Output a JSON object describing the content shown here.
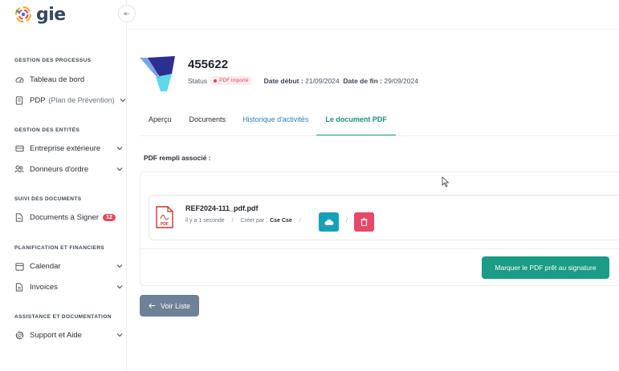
{
  "app": {
    "logo_text": "gie"
  },
  "sidebar": {
    "sections": [
      {
        "title": "GESTION DES PROCESSUS"
      },
      {
        "title": "GESTION DES ENTITÉS"
      },
      {
        "title": "SUIVI DES DOCUMENTS"
      },
      {
        "title": "PLANIFICATION ET FINANCIERS"
      },
      {
        "title": "ASSISTANCE ET DOCUMENTATION"
      }
    ],
    "items": [
      {
        "label": "Tableau de bord",
        "icon": "dashboard-icon"
      },
      {
        "label": "PDP",
        "sub": "(Plan de Prévention)",
        "icon": "document-icon"
      },
      {
        "label": "Entreprise extérieure",
        "icon": "building-icon"
      },
      {
        "label": "Donneurs d'ordre",
        "icon": "users-icon"
      },
      {
        "label": "Documents à Signer",
        "icon": "file-icon",
        "badge": "12"
      },
      {
        "label": "Calendar",
        "icon": "calendar-icon"
      },
      {
        "label": "Invoices",
        "icon": "invoice-icon"
      },
      {
        "label": "Support et Aide",
        "icon": "lifebuoy-icon"
      }
    ],
    "collapse_label": "⇤"
  },
  "header": {
    "id": "455622",
    "status_label": "Status",
    "status_badge": "PDF importé",
    "date_start_label": "Date début :",
    "date_start": "21/09/2024",
    "date_end_label": "Date de fin :",
    "date_end": "29/09/2024"
  },
  "tabs": [
    {
      "label": "Aperçu"
    },
    {
      "label": "Documents"
    },
    {
      "label": "Historique d'activités"
    },
    {
      "label": "Le document PDF"
    }
  ],
  "main": {
    "section_label": "PDF rempli associé :",
    "file": {
      "name": "REF2024-111_pdf.pdf",
      "time": "il y a 1 seconde",
      "created_by_label": "Créer par :",
      "created_by": "Cse Cse",
      "sep": "/"
    },
    "mark_button": "Marquer le PDF prêt au signature",
    "back_button": "Voir Liste"
  },
  "colors": {
    "primary": "#1a9c86",
    "danger": "#e64868",
    "info": "#16a1b8",
    "back": "#6e8196"
  }
}
